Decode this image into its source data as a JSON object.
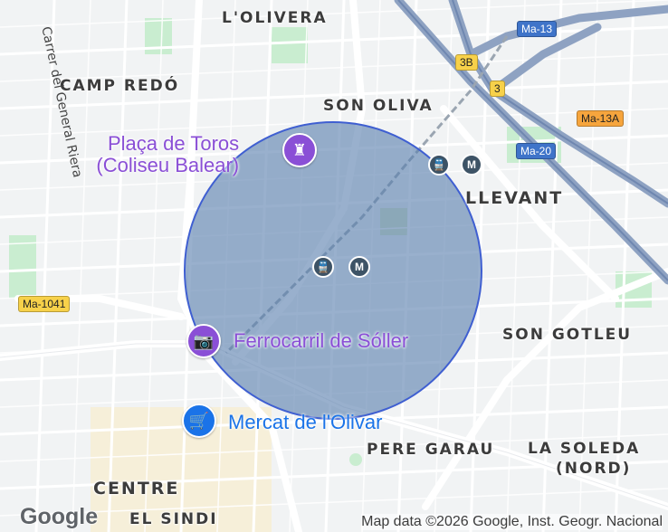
{
  "map": {
    "districts": {
      "l_olivera": "L'OLIVERA",
      "camp_redo": "CAMP REDÓ",
      "son_oliva": "SON OLIVA",
      "llevant": "LLEVANT",
      "son_gotleu": "SON GOTLEU",
      "pere_garau": "PERE GARAU",
      "la_soledat_line1": "LA SOLEDA",
      "la_soledat_line2": "(NORD)",
      "centre": "CENTRE",
      "el_sindicat": "EL SINDI"
    },
    "street_label": "Carrer del General Riera",
    "road_shields": {
      "ma13": "Ma-13",
      "exit_3b": "3B",
      "exit_3": "3",
      "ma13a": "Ma-13A",
      "ma20": "Ma-20",
      "ma1041": "Ma-1041"
    },
    "pois": {
      "placa_de_toros_line1": "Plaça de Toros",
      "placa_de_toros_line2": "(Coliseu Balear)",
      "ferrocarril": "Ferrocarril de Sóller",
      "mercat": "Mercat de l'Olivar"
    },
    "transit_icons": [
      "train-icon",
      "metro-icon"
    ],
    "transit_metro_letter": "M",
    "google_logo": "Google",
    "attribution": "Map data ©2026 Google, Inst. Geogr. Nacional",
    "colors": {
      "circle_fill": "#5a7fae",
      "circle_stroke": "#3f5fd1",
      "poi_purple": "#8a4fd6",
      "poi_blue": "#1a73e8",
      "highway": "#8ea2c2",
      "park_green": "#c9edd0"
    }
  }
}
